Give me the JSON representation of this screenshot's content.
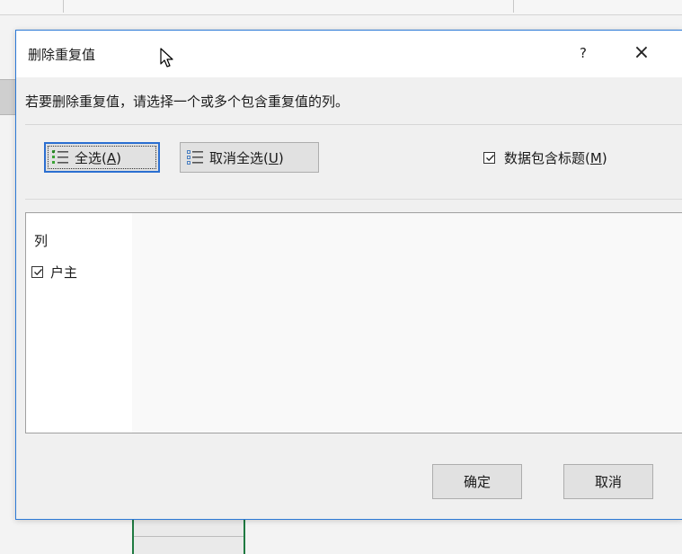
{
  "dialog": {
    "title": "删除重复值",
    "help_label": "?",
    "close_label": "×",
    "instruction": "若要删除重复值，请选择一个或多个包含重复值的列。",
    "select_all": {
      "text": "全选(",
      "mnemonic": "A",
      "suffix": ")"
    },
    "unselect_all": {
      "text": "取消全选(",
      "mnemonic": "U",
      "suffix": ")"
    },
    "has_headers": {
      "text": "数据包含标题(",
      "mnemonic": "M",
      "suffix": ")",
      "checked": true
    },
    "columns": {
      "header": "列",
      "items": [
        {
          "label": "户主",
          "checked": true
        }
      ]
    },
    "ok_label": "确定",
    "cancel_label": "取消"
  },
  "colors": {
    "accent": "#2b79d6",
    "cell_border": "#1f7a41",
    "select_icon_green": "#3aa335"
  }
}
